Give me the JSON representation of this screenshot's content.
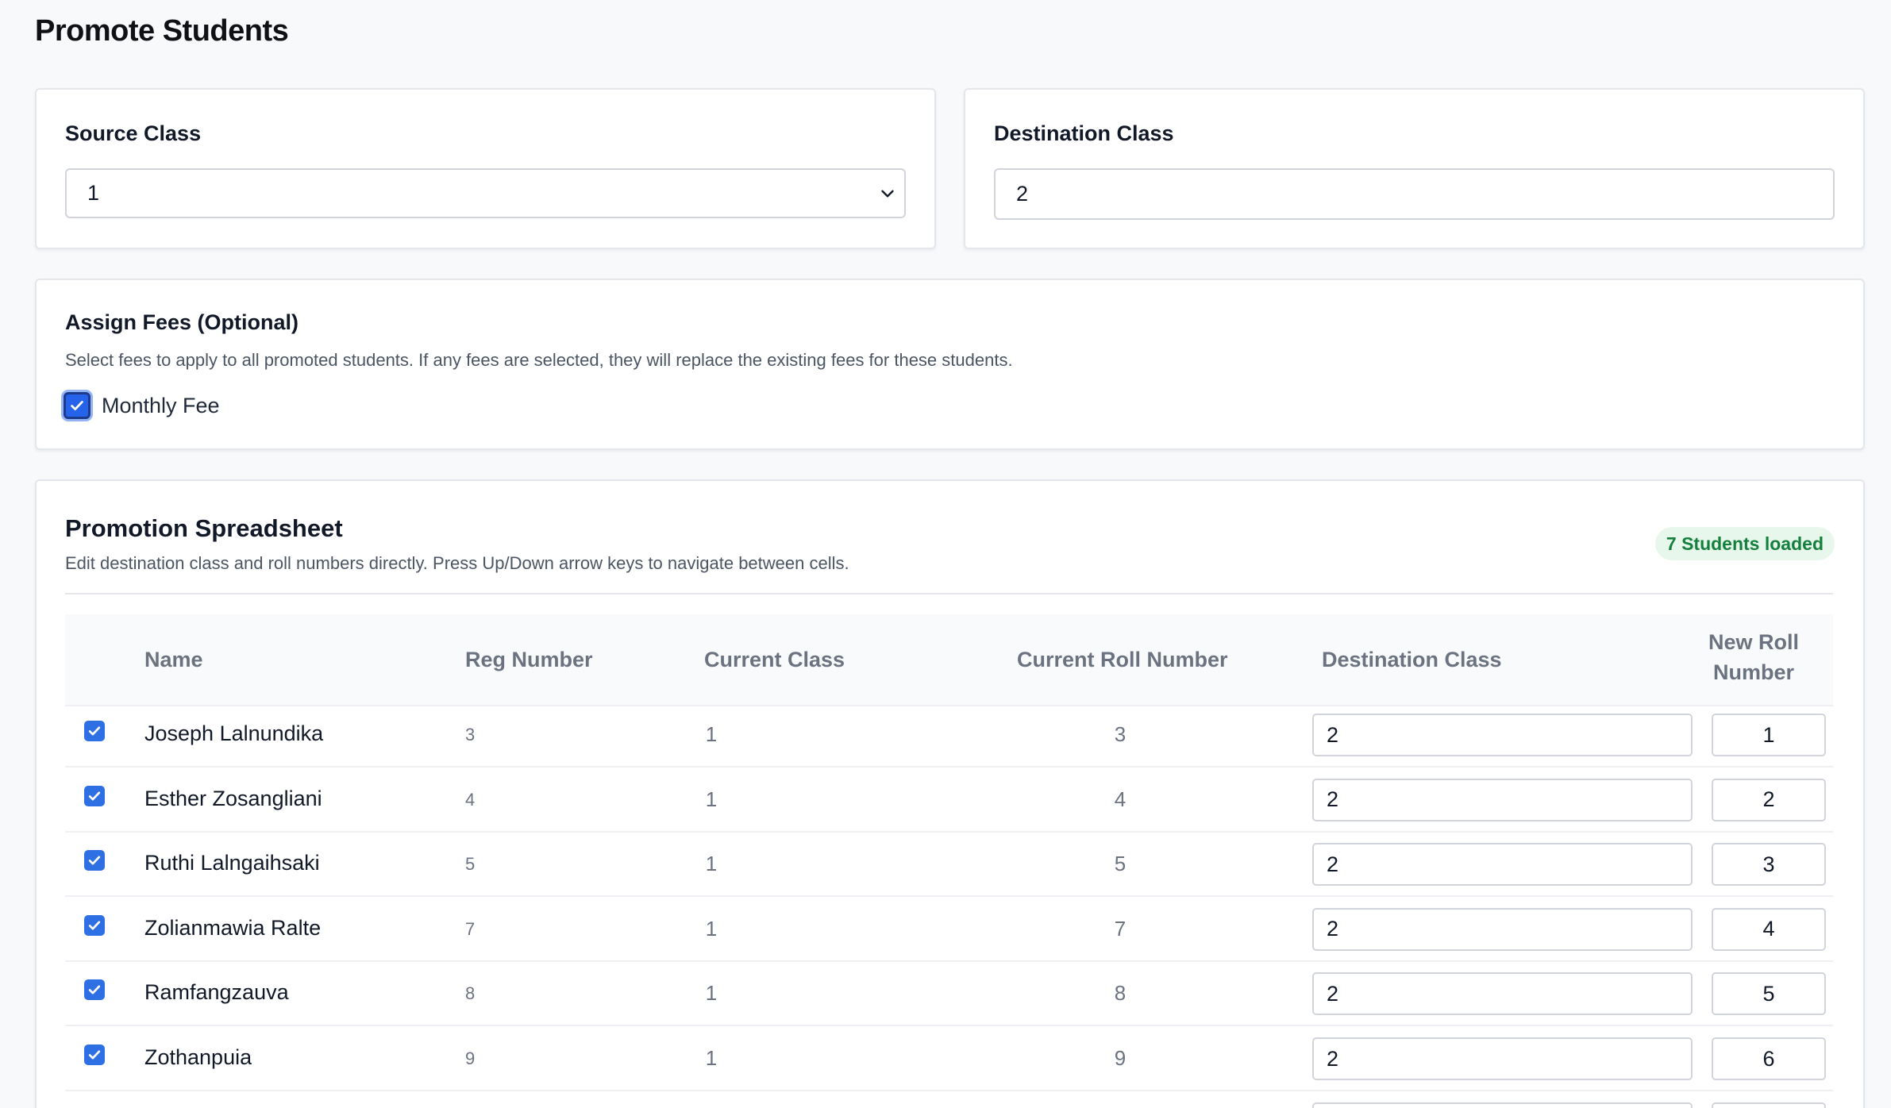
{
  "page": {
    "title": "Promote Students"
  },
  "source": {
    "label": "Source Class",
    "value": "1"
  },
  "destination": {
    "label": "Destination Class",
    "value": "2"
  },
  "fees": {
    "title": "Assign Fees (Optional)",
    "help": "Select fees to apply to all promoted students. If any fees are selected, they will replace the existing fees for these students.",
    "options": [
      {
        "label": "Monthly Fee",
        "checked": true
      }
    ]
  },
  "sheet": {
    "title": "Promotion Spreadsheet",
    "subtitle": "Edit destination class and roll numbers directly. Press Up/Down arrow keys to navigate between cells.",
    "badge": "7 Students loaded",
    "headers": {
      "name": "Name",
      "reg": "Reg Number",
      "current_class": "Current Class",
      "current_roll": "Current Roll Number",
      "dest_class": "Destination Class",
      "new_roll_1": "New Roll",
      "new_roll_2": "Number"
    },
    "rows": [
      {
        "name": "Joseph Lalnundika",
        "reg": "3",
        "current_class": "1",
        "current_roll": "3",
        "dest_class": "2",
        "new_roll": "1",
        "selected": true
      },
      {
        "name": "Esther Zosangliani",
        "reg": "4",
        "current_class": "1",
        "current_roll": "4",
        "dest_class": "2",
        "new_roll": "2",
        "selected": true
      },
      {
        "name": "Ruthi Lalngaihsaki",
        "reg": "5",
        "current_class": "1",
        "current_roll": "5",
        "dest_class": "2",
        "new_roll": "3",
        "selected": true
      },
      {
        "name": "Zolianmawia Ralte",
        "reg": "7",
        "current_class": "1",
        "current_roll": "7",
        "dest_class": "2",
        "new_roll": "4",
        "selected": true
      },
      {
        "name": "Ramfangzauva",
        "reg": "8",
        "current_class": "1",
        "current_roll": "8",
        "dest_class": "2",
        "new_roll": "5",
        "selected": true
      },
      {
        "name": "Zothanpuia",
        "reg": "9",
        "current_class": "1",
        "current_roll": "9",
        "dest_class": "2",
        "new_roll": "6",
        "selected": true
      }
    ]
  },
  "colors": {
    "accent": "#2563eb",
    "badge_bg": "#e7f7ec",
    "badge_text": "#15803d"
  }
}
